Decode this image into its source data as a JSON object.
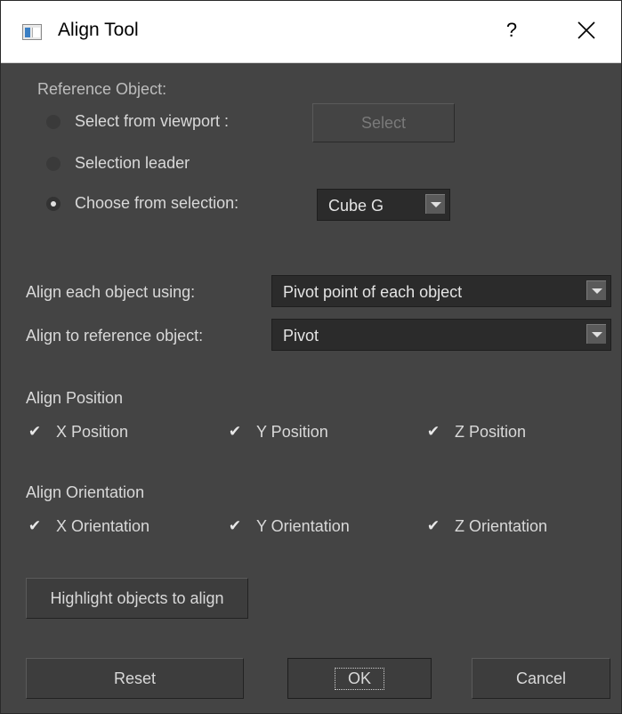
{
  "window": {
    "title": "Align Tool",
    "help_glyph": "?",
    "close_glyph": "✕"
  },
  "reference": {
    "heading": "Reference Object:",
    "opt_viewport": "Select from viewport :",
    "select_button": "Select",
    "opt_leader": "Selection leader",
    "opt_choose": "Choose from selection:",
    "selected_option": "choose",
    "choose_value": "Cube G"
  },
  "align": {
    "each_label": "Align each object using:",
    "each_value": "Pivot point of each object",
    "ref_label": "Align to reference object:",
    "ref_value": "Pivot"
  },
  "position": {
    "heading": "Align Position",
    "x": {
      "label": "X Position",
      "checked": true
    },
    "y": {
      "label": "Y Position",
      "checked": true
    },
    "z": {
      "label": "Z Position",
      "checked": true
    }
  },
  "orientation": {
    "heading": "Align Orientation",
    "x": {
      "label": "X Orientation",
      "checked": true
    },
    "y": {
      "label": "Y Orientation",
      "checked": true
    },
    "z": {
      "label": "Z Orientation",
      "checked": true
    }
  },
  "buttons": {
    "highlight": "Highlight objects to align",
    "reset": "Reset",
    "ok": "OK",
    "cancel": "Cancel"
  },
  "colors": {
    "background": "#444444",
    "text": "#d9d9d9",
    "titlebar": "#ffffff"
  },
  "check_glyph": "✔"
}
